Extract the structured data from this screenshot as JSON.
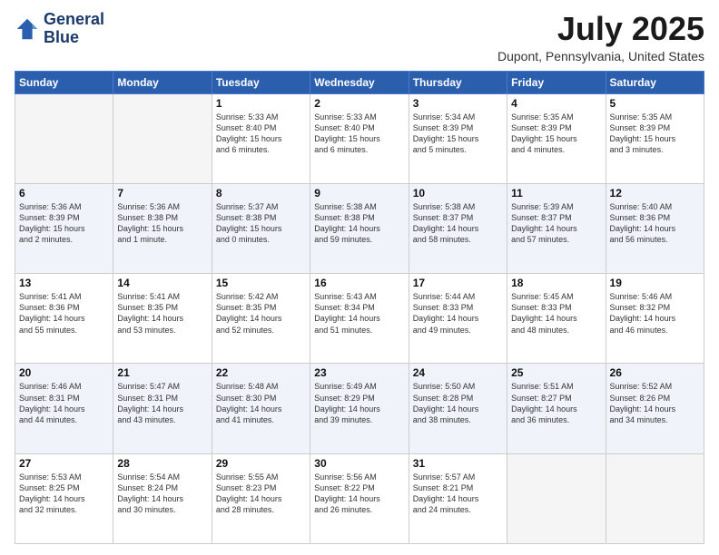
{
  "logo": {
    "line1": "General",
    "line2": "Blue"
  },
  "title": "July 2025",
  "subtitle": "Dupont, Pennsylvania, United States",
  "weekdays": [
    "Sunday",
    "Monday",
    "Tuesday",
    "Wednesday",
    "Thursday",
    "Friday",
    "Saturday"
  ],
  "weeks": [
    [
      {
        "day": "",
        "empty": true
      },
      {
        "day": "",
        "empty": true
      },
      {
        "day": "1",
        "info": "Sunrise: 5:33 AM\nSunset: 8:40 PM\nDaylight: 15 hours\nand 6 minutes."
      },
      {
        "day": "2",
        "info": "Sunrise: 5:33 AM\nSunset: 8:40 PM\nDaylight: 15 hours\nand 6 minutes."
      },
      {
        "day": "3",
        "info": "Sunrise: 5:34 AM\nSunset: 8:39 PM\nDaylight: 15 hours\nand 5 minutes."
      },
      {
        "day": "4",
        "info": "Sunrise: 5:35 AM\nSunset: 8:39 PM\nDaylight: 15 hours\nand 4 minutes."
      },
      {
        "day": "5",
        "info": "Sunrise: 5:35 AM\nSunset: 8:39 PM\nDaylight: 15 hours\nand 3 minutes."
      }
    ],
    [
      {
        "day": "6",
        "info": "Sunrise: 5:36 AM\nSunset: 8:39 PM\nDaylight: 15 hours\nand 2 minutes."
      },
      {
        "day": "7",
        "info": "Sunrise: 5:36 AM\nSunset: 8:38 PM\nDaylight: 15 hours\nand 1 minute."
      },
      {
        "day": "8",
        "info": "Sunrise: 5:37 AM\nSunset: 8:38 PM\nDaylight: 15 hours\nand 0 minutes."
      },
      {
        "day": "9",
        "info": "Sunrise: 5:38 AM\nSunset: 8:38 PM\nDaylight: 14 hours\nand 59 minutes."
      },
      {
        "day": "10",
        "info": "Sunrise: 5:38 AM\nSunset: 8:37 PM\nDaylight: 14 hours\nand 58 minutes."
      },
      {
        "day": "11",
        "info": "Sunrise: 5:39 AM\nSunset: 8:37 PM\nDaylight: 14 hours\nand 57 minutes."
      },
      {
        "day": "12",
        "info": "Sunrise: 5:40 AM\nSunset: 8:36 PM\nDaylight: 14 hours\nand 56 minutes."
      }
    ],
    [
      {
        "day": "13",
        "info": "Sunrise: 5:41 AM\nSunset: 8:36 PM\nDaylight: 14 hours\nand 55 minutes."
      },
      {
        "day": "14",
        "info": "Sunrise: 5:41 AM\nSunset: 8:35 PM\nDaylight: 14 hours\nand 53 minutes."
      },
      {
        "day": "15",
        "info": "Sunrise: 5:42 AM\nSunset: 8:35 PM\nDaylight: 14 hours\nand 52 minutes."
      },
      {
        "day": "16",
        "info": "Sunrise: 5:43 AM\nSunset: 8:34 PM\nDaylight: 14 hours\nand 51 minutes."
      },
      {
        "day": "17",
        "info": "Sunrise: 5:44 AM\nSunset: 8:33 PM\nDaylight: 14 hours\nand 49 minutes."
      },
      {
        "day": "18",
        "info": "Sunrise: 5:45 AM\nSunset: 8:33 PM\nDaylight: 14 hours\nand 48 minutes."
      },
      {
        "day": "19",
        "info": "Sunrise: 5:46 AM\nSunset: 8:32 PM\nDaylight: 14 hours\nand 46 minutes."
      }
    ],
    [
      {
        "day": "20",
        "info": "Sunrise: 5:46 AM\nSunset: 8:31 PM\nDaylight: 14 hours\nand 44 minutes."
      },
      {
        "day": "21",
        "info": "Sunrise: 5:47 AM\nSunset: 8:31 PM\nDaylight: 14 hours\nand 43 minutes."
      },
      {
        "day": "22",
        "info": "Sunrise: 5:48 AM\nSunset: 8:30 PM\nDaylight: 14 hours\nand 41 minutes."
      },
      {
        "day": "23",
        "info": "Sunrise: 5:49 AM\nSunset: 8:29 PM\nDaylight: 14 hours\nand 39 minutes."
      },
      {
        "day": "24",
        "info": "Sunrise: 5:50 AM\nSunset: 8:28 PM\nDaylight: 14 hours\nand 38 minutes."
      },
      {
        "day": "25",
        "info": "Sunrise: 5:51 AM\nSunset: 8:27 PM\nDaylight: 14 hours\nand 36 minutes."
      },
      {
        "day": "26",
        "info": "Sunrise: 5:52 AM\nSunset: 8:26 PM\nDaylight: 14 hours\nand 34 minutes."
      }
    ],
    [
      {
        "day": "27",
        "info": "Sunrise: 5:53 AM\nSunset: 8:25 PM\nDaylight: 14 hours\nand 32 minutes."
      },
      {
        "day": "28",
        "info": "Sunrise: 5:54 AM\nSunset: 8:24 PM\nDaylight: 14 hours\nand 30 minutes."
      },
      {
        "day": "29",
        "info": "Sunrise: 5:55 AM\nSunset: 8:23 PM\nDaylight: 14 hours\nand 28 minutes."
      },
      {
        "day": "30",
        "info": "Sunrise: 5:56 AM\nSunset: 8:22 PM\nDaylight: 14 hours\nand 26 minutes."
      },
      {
        "day": "31",
        "info": "Sunrise: 5:57 AM\nSunset: 8:21 PM\nDaylight: 14 hours\nand 24 minutes."
      },
      {
        "day": "",
        "empty": true
      },
      {
        "day": "",
        "empty": true
      }
    ]
  ]
}
